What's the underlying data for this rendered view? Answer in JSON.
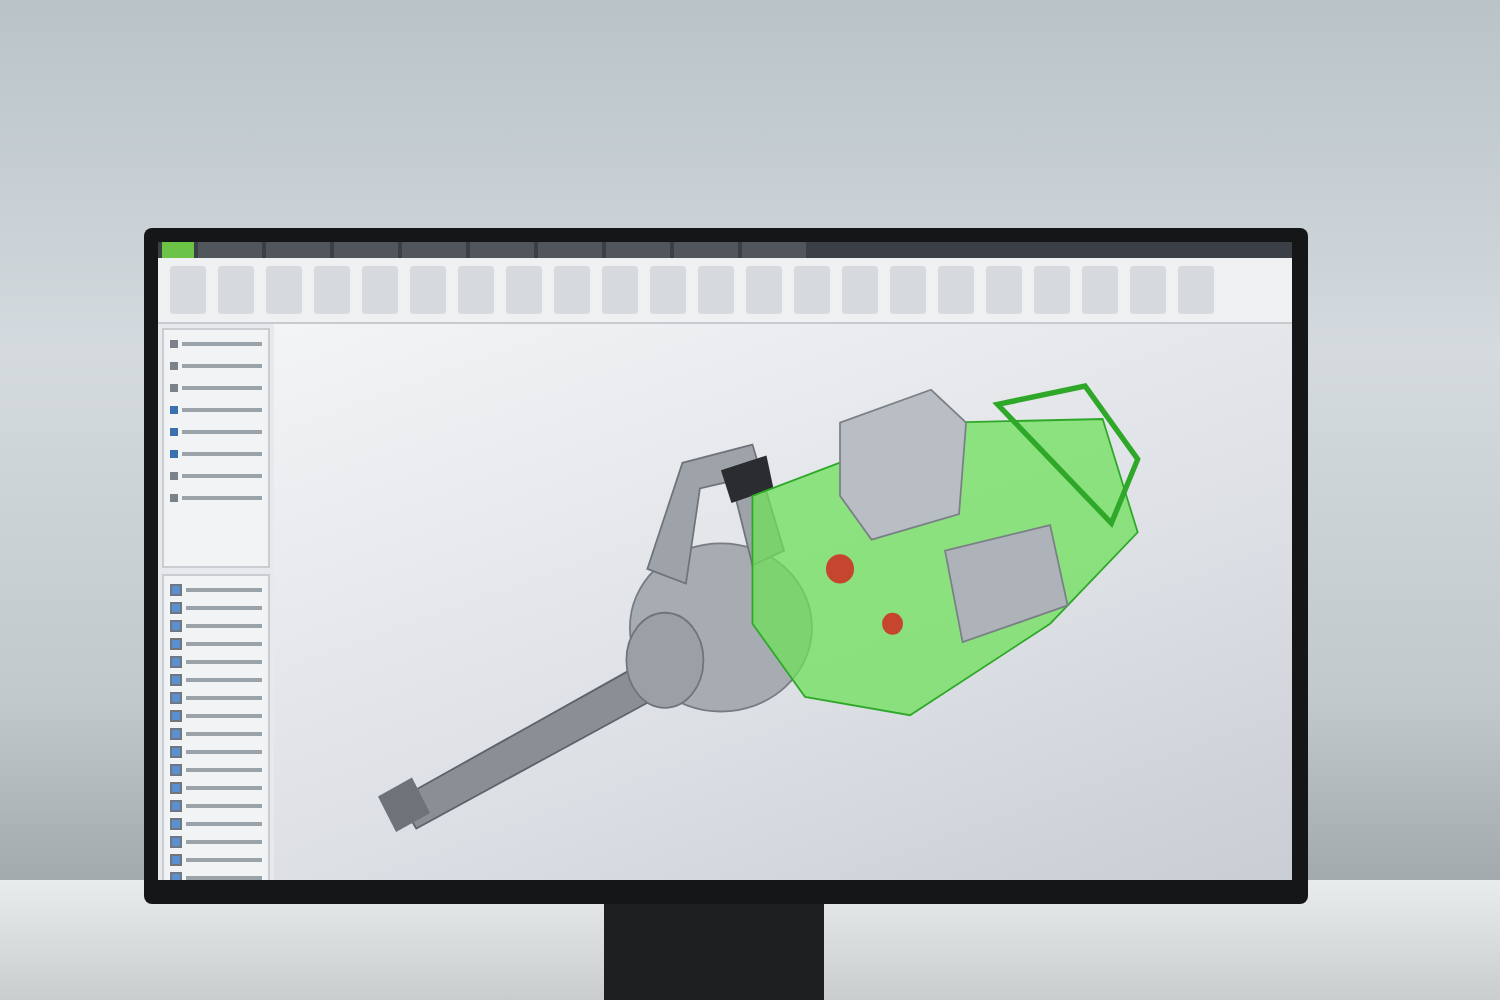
{
  "ribbon": {
    "tabs": [
      {
        "kind": "file",
        "selected": true
      },
      {
        "kind": "tab",
        "selected": false
      },
      {
        "kind": "tab",
        "selected": false
      },
      {
        "kind": "tab",
        "selected": false
      },
      {
        "kind": "tab",
        "selected": false
      },
      {
        "kind": "tab",
        "selected": false
      },
      {
        "kind": "tab",
        "selected": false
      },
      {
        "kind": "tab",
        "selected": false
      },
      {
        "kind": "tab",
        "selected": false
      },
      {
        "kind": "tab",
        "selected": false
      }
    ]
  },
  "model_tree": {
    "items": [
      {
        "expanded": false
      },
      {
        "expanded": false
      },
      {
        "expanded": false
      },
      {
        "expanded": true
      },
      {
        "expanded": true
      },
      {
        "expanded": true
      },
      {
        "expanded": false
      },
      {
        "expanded": false
      }
    ]
  },
  "parts_list": {
    "items": [
      {
        "checked": true
      },
      {
        "checked": true
      },
      {
        "checked": true
      },
      {
        "checked": true
      },
      {
        "checked": true
      },
      {
        "checked": true
      },
      {
        "checked": true
      },
      {
        "checked": true
      },
      {
        "checked": true
      },
      {
        "checked": true
      },
      {
        "checked": true
      },
      {
        "checked": true
      },
      {
        "checked": true
      },
      {
        "checked": true
      },
      {
        "checked": true
      },
      {
        "checked": true
      },
      {
        "checked": true
      }
    ]
  }
}
